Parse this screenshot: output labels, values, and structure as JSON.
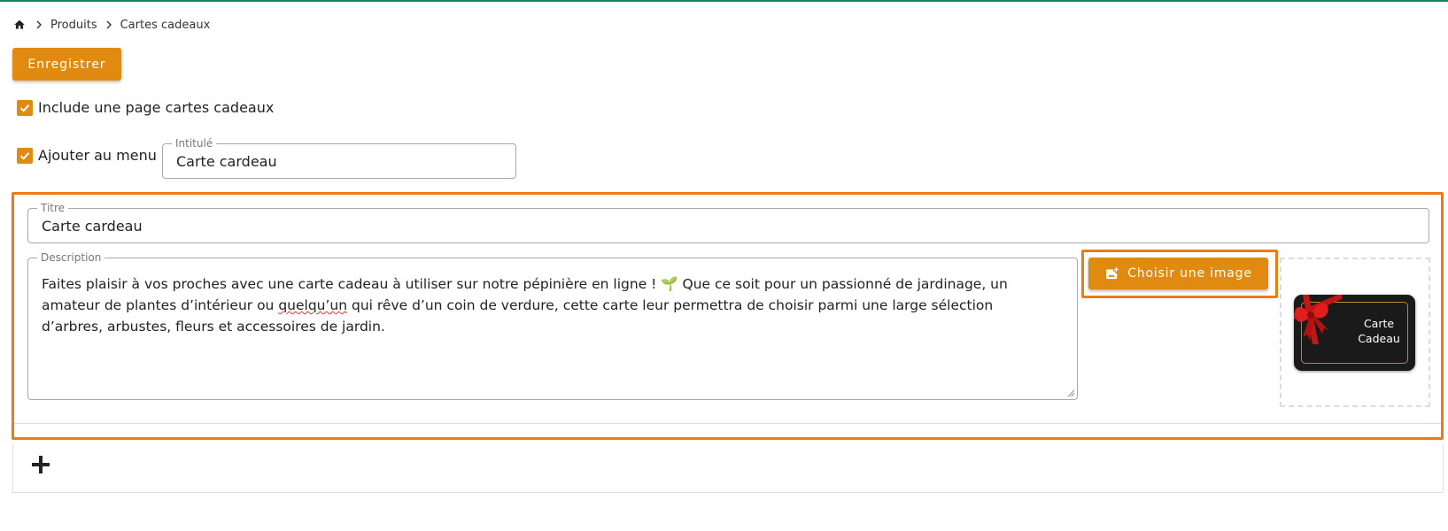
{
  "breadcrumb": {
    "home_icon": "home-icon",
    "items": [
      "Produits",
      "Cartes cadeaux"
    ]
  },
  "toolbar": {
    "save_label": "Enregistrer"
  },
  "options": {
    "include_page": {
      "label": "Include une page cartes cadeaux",
      "checked": true
    },
    "add_to_menu": {
      "label": "Ajouter au menu",
      "checked": true
    }
  },
  "menu_label_field": {
    "legend": "Intitulé",
    "value": "Carte cardeau"
  },
  "section": {
    "title_field": {
      "legend": "Titre",
      "value": "Carte cardeau"
    },
    "description_field": {
      "legend": "Description",
      "text_before": "Faites plaisir à vos proches avec une carte cadeau à utiliser sur notre pépinière en ligne ! 🌱 Que ce soit pour un passionné de jardinage, un amateur de plantes d’intérieur ou ",
      "misspelled_word": "quelqu’un",
      "text_after": " qui rêve d’un coin de verdure, cette carte leur permettra de choisir parmi une large sélection d’arbres, arbustes, fleurs et accessoires de jardin."
    },
    "choose_image_label": "Choisir une image",
    "image_preview": {
      "line1": "Carte",
      "line2": "Cadeau"
    }
  },
  "add_icon": "plus-icon",
  "colors": {
    "accent": "#e08a12",
    "highlight": "#f07a12",
    "top_bar": "#1e7f5a"
  }
}
